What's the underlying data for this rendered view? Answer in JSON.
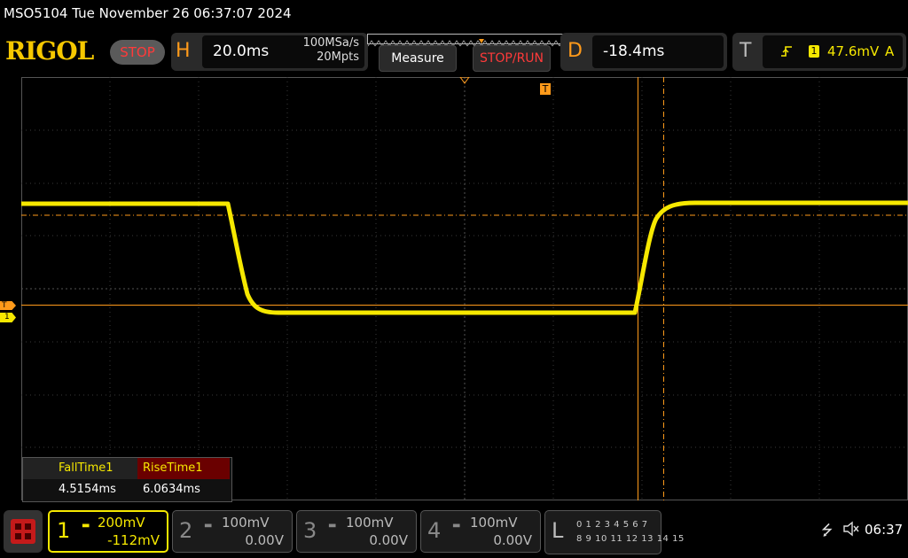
{
  "title_bar": {
    "text": "MSO5104  Tue November 26 06:37:07 2024"
  },
  "brand": {
    "logo": "RIGOL",
    "run_status": "STOP"
  },
  "horizontal": {
    "letter": "H",
    "timebase": "20.0ms",
    "sample_rate": "100MSa/s",
    "memory_depth": "20Mpts"
  },
  "buttons": {
    "measure": "Measure",
    "stop_run": "STOP/RUN"
  },
  "delay": {
    "letter": "D",
    "value": "-18.4ms"
  },
  "trigger": {
    "letter": "T",
    "channel": "1",
    "level": "47.6mV",
    "mode": "A",
    "slope_icon": "rising-edge-icon"
  },
  "markers": {
    "trigger": "T",
    "channel1": "1",
    "trigger_top": "T"
  },
  "measurements": {
    "fall_label": "FallTime1",
    "fall_value": "4.5154ms",
    "rise_label": "RiseTime1",
    "rise_value": "6.0634ms"
  },
  "channels": [
    {
      "num": "1",
      "scale": "200mV",
      "offset": "-112mV",
      "active": true,
      "color": "#f6e800"
    },
    {
      "num": "2",
      "scale": "100mV",
      "offset": "0.00V",
      "active": false,
      "color": "#bbbbbb"
    },
    {
      "num": "3",
      "scale": "100mV",
      "offset": "0.00V",
      "active": false,
      "color": "#bbbbbb"
    },
    {
      "num": "4",
      "scale": "100mV",
      "offset": "0.00V",
      "active": false,
      "color": "#bbbbbb"
    }
  ],
  "logic": {
    "letter": "L",
    "row1": "0 1 2 3   4 5 6 7",
    "row2": "8 9 10 11 12 13 14 15"
  },
  "status": {
    "time": "06:37",
    "usb_icon": "usb-icon",
    "speaker_icon": "speaker-muted-icon"
  },
  "colors": {
    "trace": "#f6e800",
    "cursor": "#ff9a1a",
    "grid": "#3a3a3a"
  }
}
